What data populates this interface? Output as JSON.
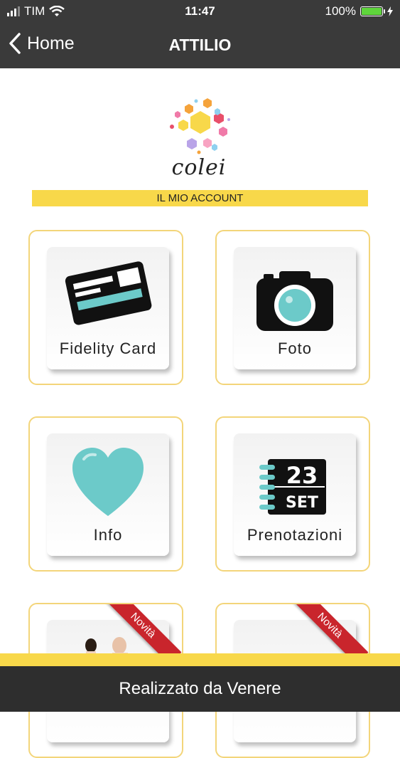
{
  "status_bar": {
    "carrier": "TIM",
    "time": "11:47",
    "battery": "100%"
  },
  "nav": {
    "back_label": "Home",
    "title": "ATTILIO"
  },
  "logo": {
    "text": "colei"
  },
  "section": {
    "title": "IL MIO ACCOUNT"
  },
  "tiles": [
    {
      "label": "Fidelity Card",
      "icon": "fidelity-card-icon"
    },
    {
      "label": "Foto",
      "icon": "camera-icon"
    },
    {
      "label": "Info",
      "icon": "heart-icon"
    },
    {
      "label": "Prenotazioni",
      "icon": "calendar-icon",
      "calendar_day": "23",
      "calendar_month": "SET"
    },
    {
      "badge": "Novità"
    },
    {
      "badge": "Novità"
    }
  ],
  "colors": {
    "bar": "#3a3a3a",
    "accent_yellow": "#f8d84a",
    "tile_border": "#f3d57a",
    "teal": "#6ccac9",
    "ribbon_red": "#c9252c"
  },
  "footer": {
    "text": "Realizzato da Venere"
  }
}
